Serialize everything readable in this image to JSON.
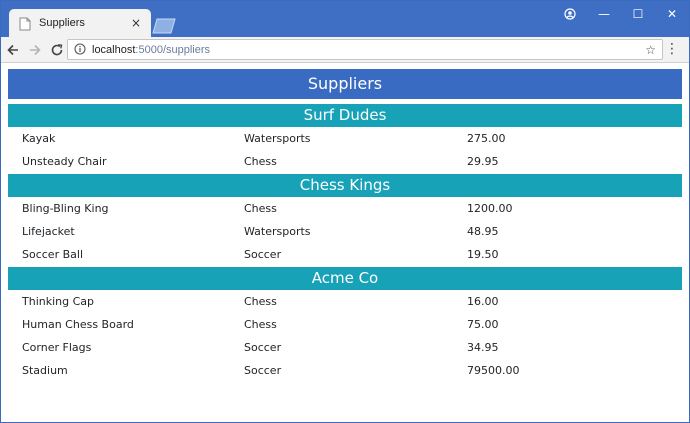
{
  "browser": {
    "tab_title": "Suppliers",
    "tab_close": "×",
    "url_host": "localhost",
    "url_path": ":5000/suppliers",
    "controls": {
      "minimize": "—",
      "maximize": "☐",
      "close": "✕"
    }
  },
  "page": {
    "title": "Suppliers",
    "suppliers": [
      {
        "name": "Surf Dudes",
        "products": [
          {
            "name": "Kayak",
            "category": "Watersports",
            "price": "275.00"
          },
          {
            "name": "Unsteady Chair",
            "category": "Chess",
            "price": "29.95"
          }
        ]
      },
      {
        "name": "Chess Kings",
        "products": [
          {
            "name": "Bling-Bling King",
            "category": "Chess",
            "price": "1200.00"
          },
          {
            "name": "Lifejacket",
            "category": "Watersports",
            "price": "48.95"
          },
          {
            "name": "Soccer Ball",
            "category": "Soccer",
            "price": "19.50"
          }
        ]
      },
      {
        "name": "Acme Co",
        "products": [
          {
            "name": "Thinking Cap",
            "category": "Chess",
            "price": "16.00"
          },
          {
            "name": "Human Chess Board",
            "category": "Chess",
            "price": "75.00"
          },
          {
            "name": "Corner Flags",
            "category": "Soccer",
            "price": "34.95"
          },
          {
            "name": "Stadium",
            "category": "Soccer",
            "price": "79500.00"
          }
        ]
      }
    ]
  },
  "colors": {
    "title_bar": "#3f6fc5",
    "page_title_bg": "#3a6bc2",
    "supplier_header_bg": "#17a2b8"
  }
}
